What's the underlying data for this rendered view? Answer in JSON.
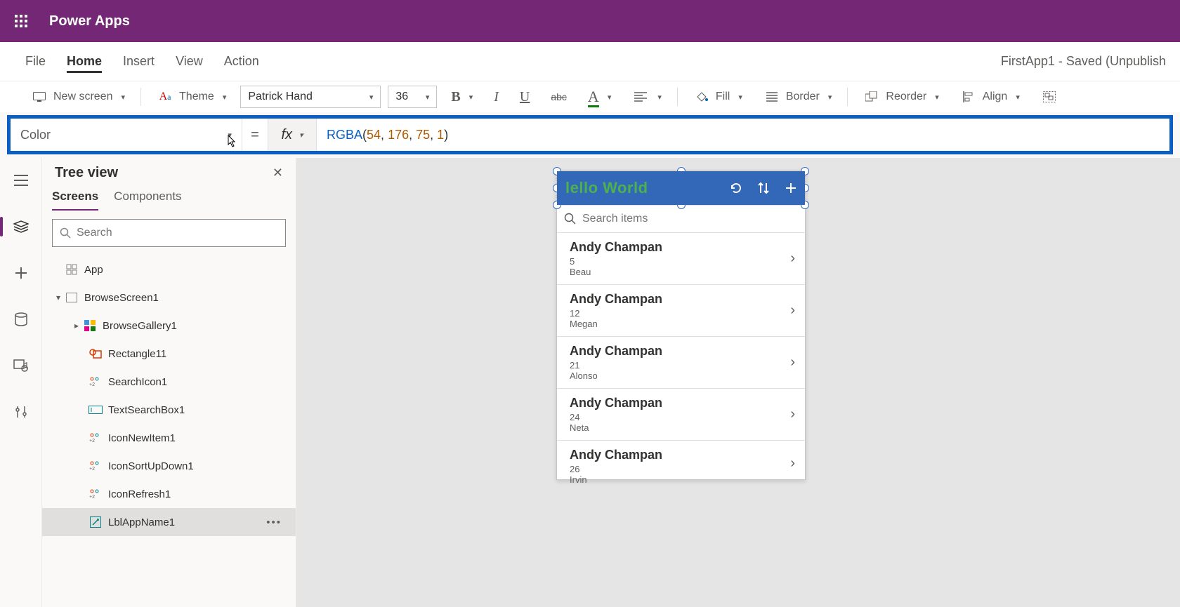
{
  "titlebar": {
    "app_title": "Power Apps"
  },
  "menu": {
    "items": [
      "File",
      "Home",
      "Insert",
      "View",
      "Action"
    ],
    "active_index": 1,
    "doc_status": "FirstApp1 - Saved (Unpublish"
  },
  "ribbon": {
    "new_screen": "New screen",
    "theme": "Theme",
    "font_name": "Patrick Hand",
    "font_size": "36",
    "fill": "Fill",
    "border": "Border",
    "reorder": "Reorder",
    "align": "Align"
  },
  "formula": {
    "property": "Color",
    "fn": "RGBA",
    "args": [
      "54",
      "176",
      "75",
      "1"
    ]
  },
  "tree": {
    "title": "Tree view",
    "tabs": [
      "Screens",
      "Components"
    ],
    "search_placeholder": "Search",
    "nodes": [
      {
        "label": "App",
        "type": "app"
      },
      {
        "label": "BrowseScreen1",
        "type": "screen"
      },
      {
        "label": "BrowseGallery1",
        "type": "gallery"
      },
      {
        "label": "Rectangle11",
        "type": "rect"
      },
      {
        "label": "SearchIcon1",
        "type": "icon"
      },
      {
        "label": "TextSearchBox1",
        "type": "textbox"
      },
      {
        "label": "IconNewItem1",
        "type": "icon"
      },
      {
        "label": "IconSortUpDown1",
        "type": "icon"
      },
      {
        "label": "IconRefresh1",
        "type": "icon"
      },
      {
        "label": "LblAppName1",
        "type": "label",
        "selected": true
      }
    ]
  },
  "phone": {
    "title": "lello World",
    "search_placeholder": "Search items",
    "list": [
      {
        "name": "Andy Champan",
        "sub1": "5",
        "sub2": "Beau"
      },
      {
        "name": "Andy Champan",
        "sub1": "12",
        "sub2": "Megan"
      },
      {
        "name": "Andy Champan",
        "sub1": "21",
        "sub2": "Alonso"
      },
      {
        "name": "Andy Champan",
        "sub1": "24",
        "sub2": "Neta"
      },
      {
        "name": "Andy Champan",
        "sub1": "26",
        "sub2": "Irvin"
      }
    ]
  }
}
